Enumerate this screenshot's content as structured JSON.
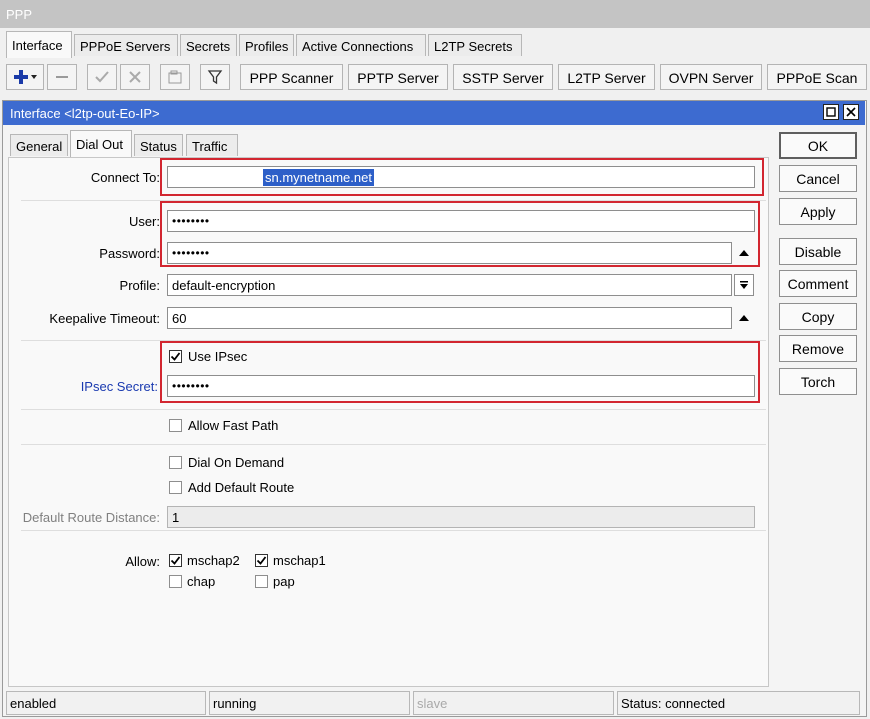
{
  "window": {
    "title": "PPP"
  },
  "tabs": [
    "Interface",
    "PPPoE Servers",
    "Secrets",
    "Profiles",
    "Active Connections",
    "L2TP Secrets"
  ],
  "toolbar": {
    "icons": [
      "plus-dropdown-icon",
      "minus-icon",
      "check-icon",
      "cross-icon",
      "note-icon",
      "filter-icon"
    ],
    "buttons": [
      "PPP Scanner",
      "PPTP Server",
      "SSTP Server",
      "L2TP Server",
      "OVPN Server",
      "PPPoE Scan"
    ]
  },
  "dialog": {
    "title": "Interface <l2tp-out-Eo-IP>",
    "tabs": [
      "General",
      "Dial Out",
      "Status",
      "Traffic"
    ],
    "active_tab": "Dial Out",
    "fields": {
      "connect_to": {
        "label": "Connect To:",
        "value": "sn.mynetname.net"
      },
      "user": {
        "label": "User:",
        "value": "••••••••"
      },
      "password": {
        "label": "Password:",
        "value": "••••••••"
      },
      "profile": {
        "label": "Profile:",
        "value": "default-encryption"
      },
      "keepalive_timeout": {
        "label": "Keepalive Timeout:",
        "value": "60"
      },
      "use_ipsec": {
        "label": "Use IPsec",
        "checked": true
      },
      "ipsec_secret": {
        "label": "IPsec Secret:",
        "value": "••••••••"
      },
      "allow_fast_path": {
        "label": "Allow Fast Path",
        "checked": false
      },
      "dial_on_demand": {
        "label": "Dial On Demand",
        "checked": false
      },
      "add_default_route": {
        "label": "Add Default Route",
        "checked": false
      },
      "default_route_distance": {
        "label": "Default Route Distance:",
        "value": "1"
      },
      "allow": {
        "label": "Allow:",
        "options": [
          {
            "label": "mschap2",
            "checked": true
          },
          {
            "label": "mschap1",
            "checked": true
          },
          {
            "label": "chap",
            "checked": false
          },
          {
            "label": "pap",
            "checked": false
          }
        ]
      }
    },
    "buttons": [
      "OK",
      "Cancel",
      "Apply",
      "Disable",
      "Comment",
      "Copy",
      "Remove",
      "Torch"
    ]
  },
  "statusbar": [
    "enabled",
    "running",
    "slave",
    "Status: connected"
  ],
  "colors": {
    "highlight": "#d22630",
    "title_bar": "#3d6bd0",
    "ipsec_label": "#1a3ab0"
  }
}
